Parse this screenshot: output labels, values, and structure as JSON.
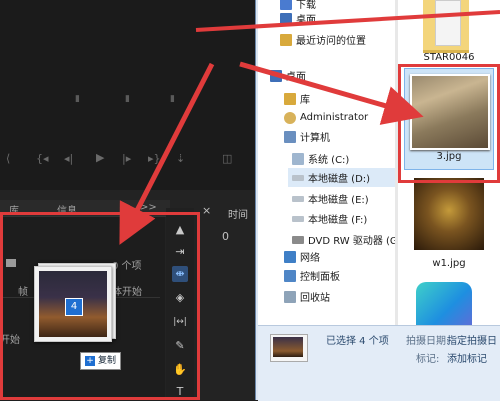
{
  "editor": {
    "panel_tabs": [
      "库",
      "信息"
    ],
    "panel_more": ">>",
    "timeline_label": "时间",
    "timecode_zero": "0",
    "items_suffix": "0 个项",
    "media_start_fragment": "体开始",
    "column_head": "帧",
    "start_label": "开始",
    "drag_count": "4",
    "copy_label": "复制"
  },
  "tools": [
    {
      "name": "selection-tool-icon",
      "glyph": "▲"
    },
    {
      "name": "track-select-tool-icon",
      "glyph": "⇥"
    },
    {
      "name": "ripple-edit-tool-icon",
      "glyph": "⇼"
    },
    {
      "name": "razor-tool-icon",
      "glyph": "◈"
    },
    {
      "name": "slip-tool-icon",
      "glyph": "|↔|"
    },
    {
      "name": "pen-tool-icon",
      "glyph": "✎"
    },
    {
      "name": "hand-tool-icon",
      "glyph": "✋"
    },
    {
      "name": "type-tool-icon",
      "glyph": "T"
    }
  ],
  "explorer": {
    "nav": [
      {
        "label": "下载",
        "icon": "#4a7bd0"
      },
      {
        "label": "桌面",
        "icon": "#3e6fb8"
      },
      {
        "label": "最近访问的位置",
        "icon": "#d8a93c"
      },
      {
        "label": "",
        "icon": ""
      },
      {
        "label": "桌面",
        "icon": "#3e6fb8"
      },
      {
        "label": "库",
        "icon": "#d8a93c"
      },
      {
        "label": "Administrator",
        "icon": "#d8b25a"
      },
      {
        "label": "计算机",
        "icon": "#6a8fbf"
      },
      {
        "label": "系统 (C:)",
        "icon": "#9fb6cf"
      },
      {
        "label": "本地磁盘 (D:)",
        "icon": "#b9c2cb"
      },
      {
        "label": "本地磁盘 (E:)",
        "icon": "#b9c2cb"
      },
      {
        "label": "本地磁盘 (F:)",
        "icon": "#b9c2cb"
      },
      {
        "label": "DVD RW 驱动器 (G:)",
        "icon": "#8a8a8a"
      },
      {
        "label": "网络",
        "icon": "#3f7fc6"
      },
      {
        "label": "控制面板",
        "icon": "#4f86c6"
      },
      {
        "label": "回收站",
        "icon": "#8ea3b8"
      }
    ],
    "files": [
      {
        "name": "STAR0046"
      },
      {
        "name": "3.jpg"
      },
      {
        "name": "w1.jpg"
      }
    ],
    "status": {
      "selected": "已选择 4 个项",
      "shot_date_label": "拍摄日期:",
      "shot_date_value": "指定拍摄日",
      "tags_label": "标记:",
      "tags_value": "添加标记"
    }
  },
  "colors": {
    "highlight_red": "#e03b3b",
    "accent_blue": "#1f6fd1"
  }
}
